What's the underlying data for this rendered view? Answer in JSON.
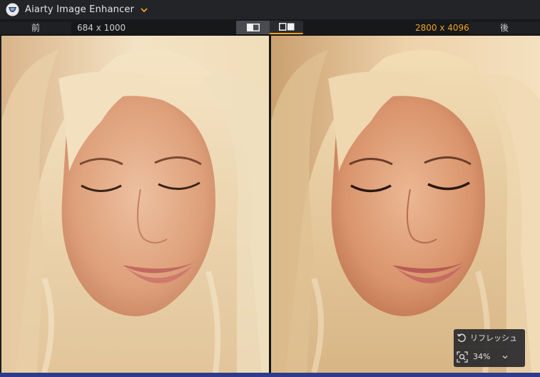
{
  "app": {
    "title": "Aiarty Image Enhancer"
  },
  "toolbar": {
    "before_label": "前",
    "before_resolution": "684 x 1000",
    "after_resolution": "2800 x 4096",
    "after_label": "後",
    "view_modes": [
      "single-view-icon",
      "split-view-icon"
    ],
    "active_view": "split"
  },
  "zoom_panel": {
    "refresh_label": "リフレッシュ",
    "zoom_value": "34%"
  },
  "colors": {
    "accent": "#f0a324",
    "titlebar": "#232428",
    "toolbar": "#17181a",
    "bottom_bar": "#2e3a8a"
  }
}
